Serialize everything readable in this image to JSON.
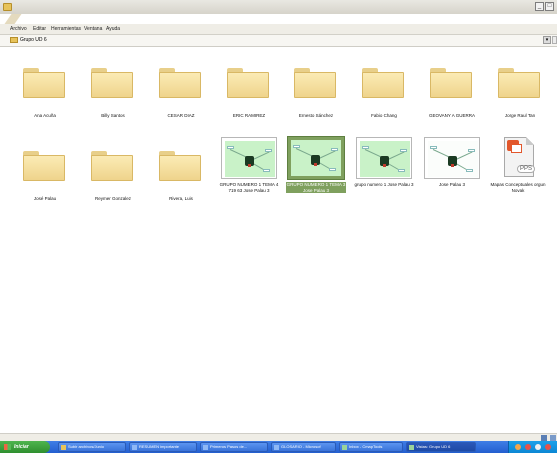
{
  "window": {
    "minimize_glyph": "_",
    "maximize_glyph": "□"
  },
  "menu": [
    {
      "label": "Archivo"
    },
    {
      "label": "Editar"
    },
    {
      "label": "Herramientas"
    },
    {
      "label": "Ventana"
    },
    {
      "label": "Ayuda"
    }
  ],
  "address": {
    "path": "Grupo UD 6",
    "go_glyph": "▾"
  },
  "items": [
    {
      "type": "folder",
      "label": "Ana Acuña"
    },
    {
      "type": "folder",
      "label": "Billy  Santos"
    },
    {
      "type": "folder",
      "label": "CESAR DIAZ"
    },
    {
      "type": "folder",
      "label": "ERIC RAMIREZ"
    },
    {
      "type": "folder",
      "label": "Ernesto Sánchez"
    },
    {
      "type": "folder",
      "label": "Fabio Chang"
    },
    {
      "type": "folder",
      "label": "GEOVANY A GUERRA"
    },
    {
      "type": "folder",
      "label": "Jorge Raul Tan"
    },
    {
      "type": "folder",
      "label": "José Palau"
    },
    {
      "type": "folder",
      "label": "Reymer Gonzalez"
    },
    {
      "type": "folder",
      "label": "Rivera, Luis"
    },
    {
      "type": "mindmap",
      "label": "GRUPO NUMERO 1 TEMA 4 719 63 Jose Palau 3",
      "selected": false
    },
    {
      "type": "mindmap",
      "label": "GRUPO NUMERO 1 TEMA 3 Jose Palau 3",
      "selected": true
    },
    {
      "type": "mindmap",
      "label": "grupo numero 1 Jose Palau 3",
      "selected": false
    },
    {
      "type": "mindmap-white",
      "label": "Jose Palau 3",
      "selected": false
    },
    {
      "type": "pps",
      "label": "Mapas Conceptuales orgun Novak",
      "badge": "PPS"
    }
  ],
  "taskbar": {
    "start_label": "Iniciar",
    "buttons": [
      {
        "label": "Subir archivos/Junio"
      },
      {
        "label": "RESUMEN importante"
      },
      {
        "label": "Primeros Pasos de..."
      },
      {
        "label": "GLOSARIO - Microsof"
      },
      {
        "label": "Inbox - CmapTools"
      },
      {
        "label": "Vistas: Grupo UD 6"
      }
    ]
  },
  "colors": {
    "selected_bg": "#7fa05e",
    "taskbar_blue": "#2f6bd9",
    "start_green": "#3da33d"
  }
}
